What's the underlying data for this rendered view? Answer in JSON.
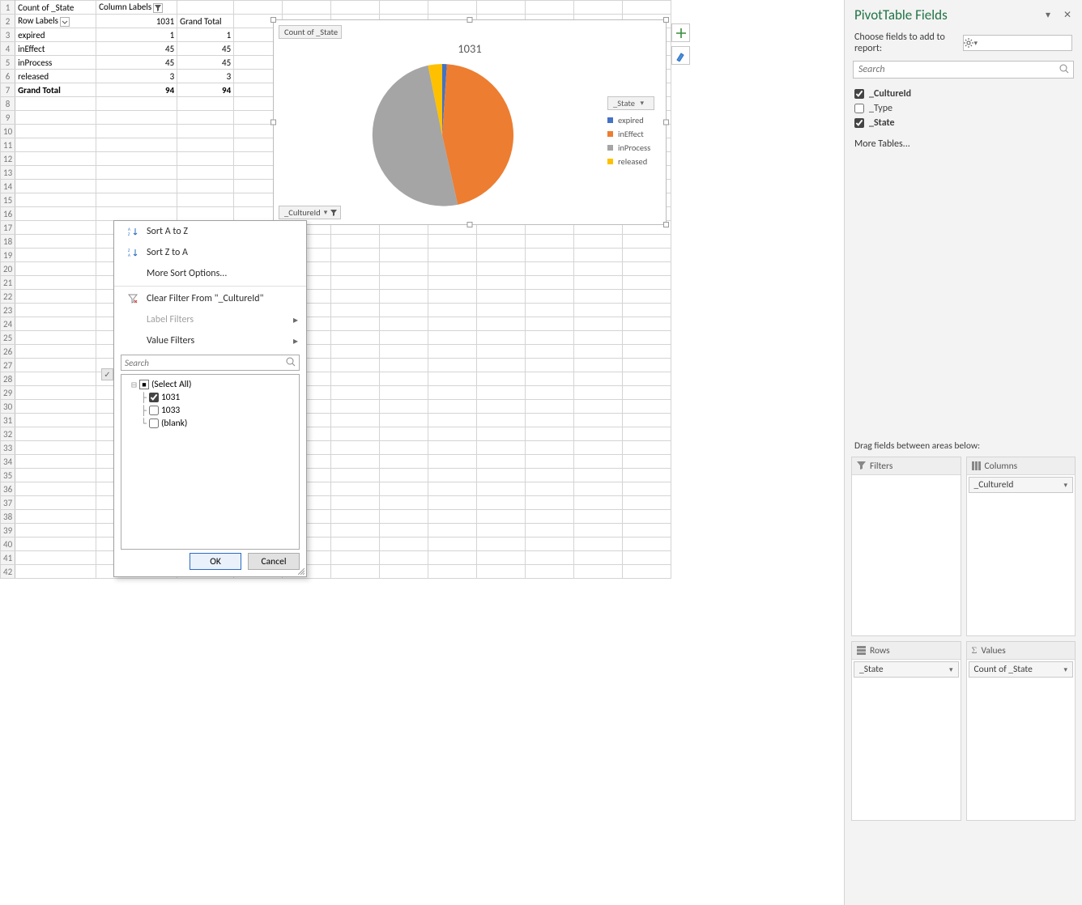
{
  "pivot": {
    "header": {
      "measure": "Count of _State",
      "column_labels": "Column Labels",
      "row_labels": "Row Labels",
      "col_value": "1031",
      "grand_total": "Grand Total"
    },
    "rows": [
      {
        "label": "expired",
        "v": "1",
        "gt": "1"
      },
      {
        "label": "inEffect",
        "v": "45",
        "gt": "45"
      },
      {
        "label": "inProcess",
        "v": "45",
        "gt": "45"
      },
      {
        "label": "released",
        "v": "3",
        "gt": "3"
      }
    ],
    "total": {
      "label": "Grand Total",
      "v": "94",
      "gt": "94"
    }
  },
  "chart_data": {
    "type": "pie",
    "title": "1031",
    "field_count": "Count of _State",
    "field_axis": "_CultureId",
    "legend_field": "_State",
    "categories": [
      "expired",
      "inEffect",
      "inProcess",
      "released"
    ],
    "values": [
      1,
      45,
      45,
      3
    ],
    "colors": [
      "#4472c4",
      "#ed7d31",
      "#a5a5a5",
      "#ffc000"
    ]
  },
  "dropdown": {
    "sort_az": "Sort A to Z",
    "sort_za": "Sort Z to A",
    "more_sort": "More Sort Options...",
    "clear_filter": "Clear Filter From \"_CultureId\"",
    "label_filters": "Label Filters",
    "value_filters": "Value Filters",
    "search_placeholder": "Search",
    "items": [
      {
        "label": "(Select All)",
        "state": "mixed"
      },
      {
        "label": "1031",
        "state": "checked"
      },
      {
        "label": "1033",
        "state": "unchecked"
      },
      {
        "label": "(blank)",
        "state": "unchecked"
      }
    ],
    "ok": "OK",
    "cancel": "Cancel"
  },
  "pane": {
    "title": "PivotTable Fields",
    "subtitle": "Choose fields to add to report:",
    "search_placeholder": "Search",
    "fields": [
      {
        "name": "_CultureId",
        "checked": true
      },
      {
        "name": "_Type",
        "checked": false
      },
      {
        "name": "_State",
        "checked": true
      }
    ],
    "more_tables": "More Tables...",
    "areas_label": "Drag fields between areas below:",
    "areas": {
      "filters": "Filters",
      "columns": "Columns",
      "rows": "Rows",
      "values": "Values",
      "columns_pill": "_CultureId",
      "rows_pill": "_State",
      "values_pill": "Count of _State"
    }
  }
}
